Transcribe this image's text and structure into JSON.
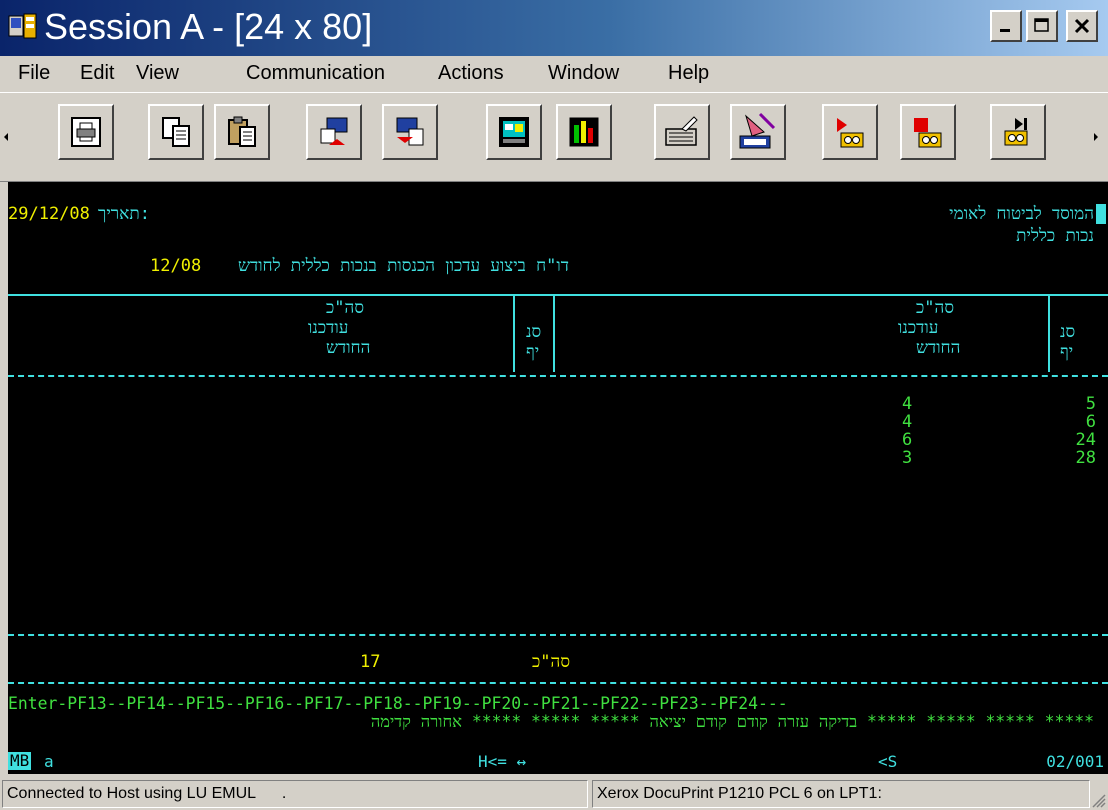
{
  "window": {
    "title": "Session A - [24 x 80]"
  },
  "menu": [
    {
      "label": "File"
    },
    {
      "label": "Edit"
    },
    {
      "label": "View"
    },
    {
      "label": "Communication"
    },
    {
      "label": "Actions"
    },
    {
      "label": "Window"
    },
    {
      "label": "Help"
    }
  ],
  "toolbar": [
    {
      "icon": "print-screen-icon"
    },
    {
      "icon": "copy-icon"
    },
    {
      "icon": "paste-icon"
    },
    {
      "icon": "send-file-icon"
    },
    {
      "icon": "receive-file-icon"
    },
    {
      "icon": "display-setup-icon"
    },
    {
      "icon": "color-map-icon"
    },
    {
      "icon": "keyboard-map-icon"
    },
    {
      "icon": "macro-wizard-icon"
    },
    {
      "icon": "record-macro-icon"
    },
    {
      "icon": "stop-macro-icon"
    },
    {
      "icon": "play-macro-icon"
    }
  ],
  "terminal": {
    "org_name": "המוסד לביטוח לאומי",
    "dept": "נכות כללית",
    "date_label": "תאריך:",
    "date_value": "29/12/08",
    "report_title": "דו\"ח ביצוע עדכון הכנסות בנכות כללית לחודש",
    "report_month": "12/08",
    "col_left_total_1": "סה\"כ",
    "col_left_total_2": "עודכנו",
    "col_left_total_3": "החודש",
    "col_left_branch_1": "סנ",
    "col_left_branch_2": "יף",
    "col_right_total_1": "סה\"כ",
    "col_right_total_2": "עודכנו",
    "col_right_total_3": "החודש",
    "col_right_branch_1": "סנ",
    "col_right_branch_2": "יף",
    "rows": [
      {
        "updated": "4",
        "branch": "5"
      },
      {
        "updated": "4",
        "branch": "6"
      },
      {
        "updated": "6",
        "branch": "24"
      },
      {
        "updated": "3",
        "branch": "28"
      }
    ],
    "total_value": "17",
    "total_label": "סה\"כ",
    "pf_line": "Enter-PF13--PF14--PF15--PF16--PF17--PF18--PF19--PF20--PF21--PF22--PF23--PF24---",
    "pf_labels": "בדיקה  עזרה  קודם  קודם  יציאה ***** ***** ***** אחורה קדימה ***** ***** ***** *****"
  },
  "oia": {
    "mode": "MB",
    "session": "a",
    "insert": "H<= ↔",
    "shift": "<S",
    "cursor": "02/001"
  },
  "status": {
    "connection": "Connected to Host using LU EMUL",
    "dot": ".",
    "printer": "Xerox DocuPrint P1210 PCL 6 on LPT1:"
  }
}
